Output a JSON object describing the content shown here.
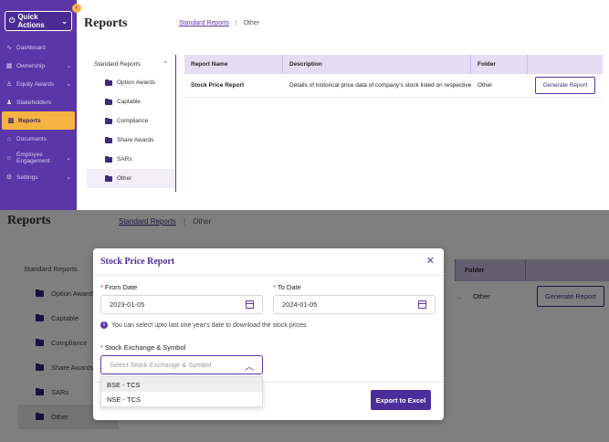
{
  "sidebar": {
    "quick_actions": "Quick Actions",
    "items": [
      {
        "label": "Dashboard",
        "icon": "pulse-icon",
        "chevron": false
      },
      {
        "label": "Ownership",
        "icon": "ownership-icon",
        "chevron": true
      },
      {
        "label": "Equity Awards",
        "icon": "equity-awards-icon",
        "chevron": true
      },
      {
        "label": "Stakeholders",
        "icon": "stakeholders-icon",
        "chevron": false
      },
      {
        "label": "Reports",
        "icon": "reports-icon",
        "chevron": false,
        "active": true
      },
      {
        "label": "Documents",
        "icon": "documents-icon",
        "chevron": false
      },
      {
        "label": "Employee Engagement",
        "icon": "engagement-icon",
        "chevron": true
      },
      {
        "label": "Settings",
        "icon": "gear-icon",
        "chevron": true
      }
    ]
  },
  "header": {
    "title": "Reports",
    "breadcrumb": [
      "Standard Reports",
      "Other"
    ]
  },
  "report_tree": {
    "heading": "Standard Reports",
    "items": [
      "Option Awards",
      "Captable",
      "Compliance",
      "Share Awards",
      "SARs",
      "Other"
    ],
    "selected": "Other"
  },
  "table": {
    "columns": [
      "Report Name",
      "Description",
      "Folder",
      ""
    ],
    "rows": [
      {
        "name": "Stock Price Report",
        "description": "Details of historical price data of company's stock listed on respective...",
        "description_truncated": "...",
        "folder": "Other",
        "action": "Generate Report"
      }
    ]
  },
  "modal": {
    "title": "Stock Price Report",
    "from_label": "From Date",
    "from_value": "2023-01-05",
    "to_label": "To Date",
    "to_value": "2024-01-05",
    "info": "You can select upto last one year's date to download the stock prices",
    "exchange_label": "Stock Exchange & Symbol",
    "exchange_placeholder": "Select Stock Exchange & Symbol",
    "options": [
      "BSE - TCS",
      "NSE - TCS"
    ],
    "export_label": "Export to Excel"
  },
  "colors": {
    "brand": "#5b36a8",
    "accent": "#f5b342",
    "required": "#e6372e"
  }
}
